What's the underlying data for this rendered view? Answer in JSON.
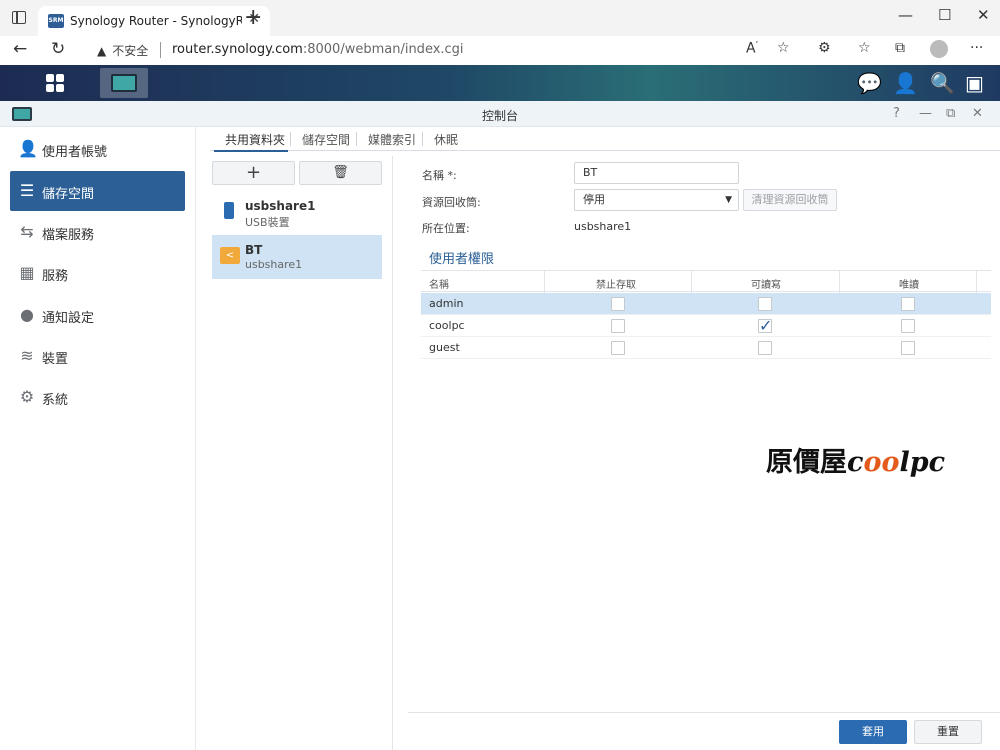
{
  "browser": {
    "tab_title": "Synology Router - SynologyRouter",
    "tab_favicon": "SRM",
    "security_label": "不安全",
    "url_host": "router.synology.com",
    "url_path": ":8000/webman/index.cgi"
  },
  "window": {
    "title": "控制台"
  },
  "sidebar": {
    "items": [
      {
        "label": "使用者帳號",
        "icon": "user-icon"
      },
      {
        "label": "儲存空間",
        "icon": "database-icon"
      },
      {
        "label": "檔案服務",
        "icon": "file-transfer-icon"
      },
      {
        "label": "服務",
        "icon": "grid-icon"
      },
      {
        "label": "通知設定",
        "icon": "chat-icon"
      },
      {
        "label": "裝置",
        "icon": "router-icon"
      },
      {
        "label": "系統",
        "icon": "gear-icon"
      }
    ],
    "active_index": 1
  },
  "tabs": [
    {
      "label": "共用資料夾"
    },
    {
      "label": "儲存空間"
    },
    {
      "label": "媒體索引"
    },
    {
      "label": "休眠"
    }
  ],
  "list": {
    "items": [
      {
        "name": "usbshare1",
        "sub": "USB裝置"
      },
      {
        "name": "BT",
        "sub": "usbshare1"
      }
    ]
  },
  "form": {
    "name_label": "名稱 *:",
    "name_value": "BT",
    "recycle_label": "資源回收筒:",
    "recycle_value": "停用",
    "recycle_button": "清理資源回收筒",
    "location_label": "所在位置:",
    "location_value": "usbshare1",
    "section_title": "使用者權限"
  },
  "table": {
    "headers": [
      "名稱",
      "禁止存取",
      "可讀寫",
      "唯讀"
    ],
    "rows": [
      {
        "name": "admin",
        "deny": false,
        "rw": false,
        "ro": false
      },
      {
        "name": "coolpc",
        "deny": false,
        "rw": true,
        "ro": false
      },
      {
        "name": "guest",
        "deny": false,
        "rw": false,
        "ro": false
      }
    ]
  },
  "watermark": {
    "prefix": "原價屋",
    "c": "c",
    "oo": "oo",
    "lpc": "lpc"
  },
  "footer": {
    "apply": "套用",
    "reset": "重置"
  },
  "colors": {
    "accent": "#2b5f96",
    "selected_row": "#cfe3f5"
  }
}
